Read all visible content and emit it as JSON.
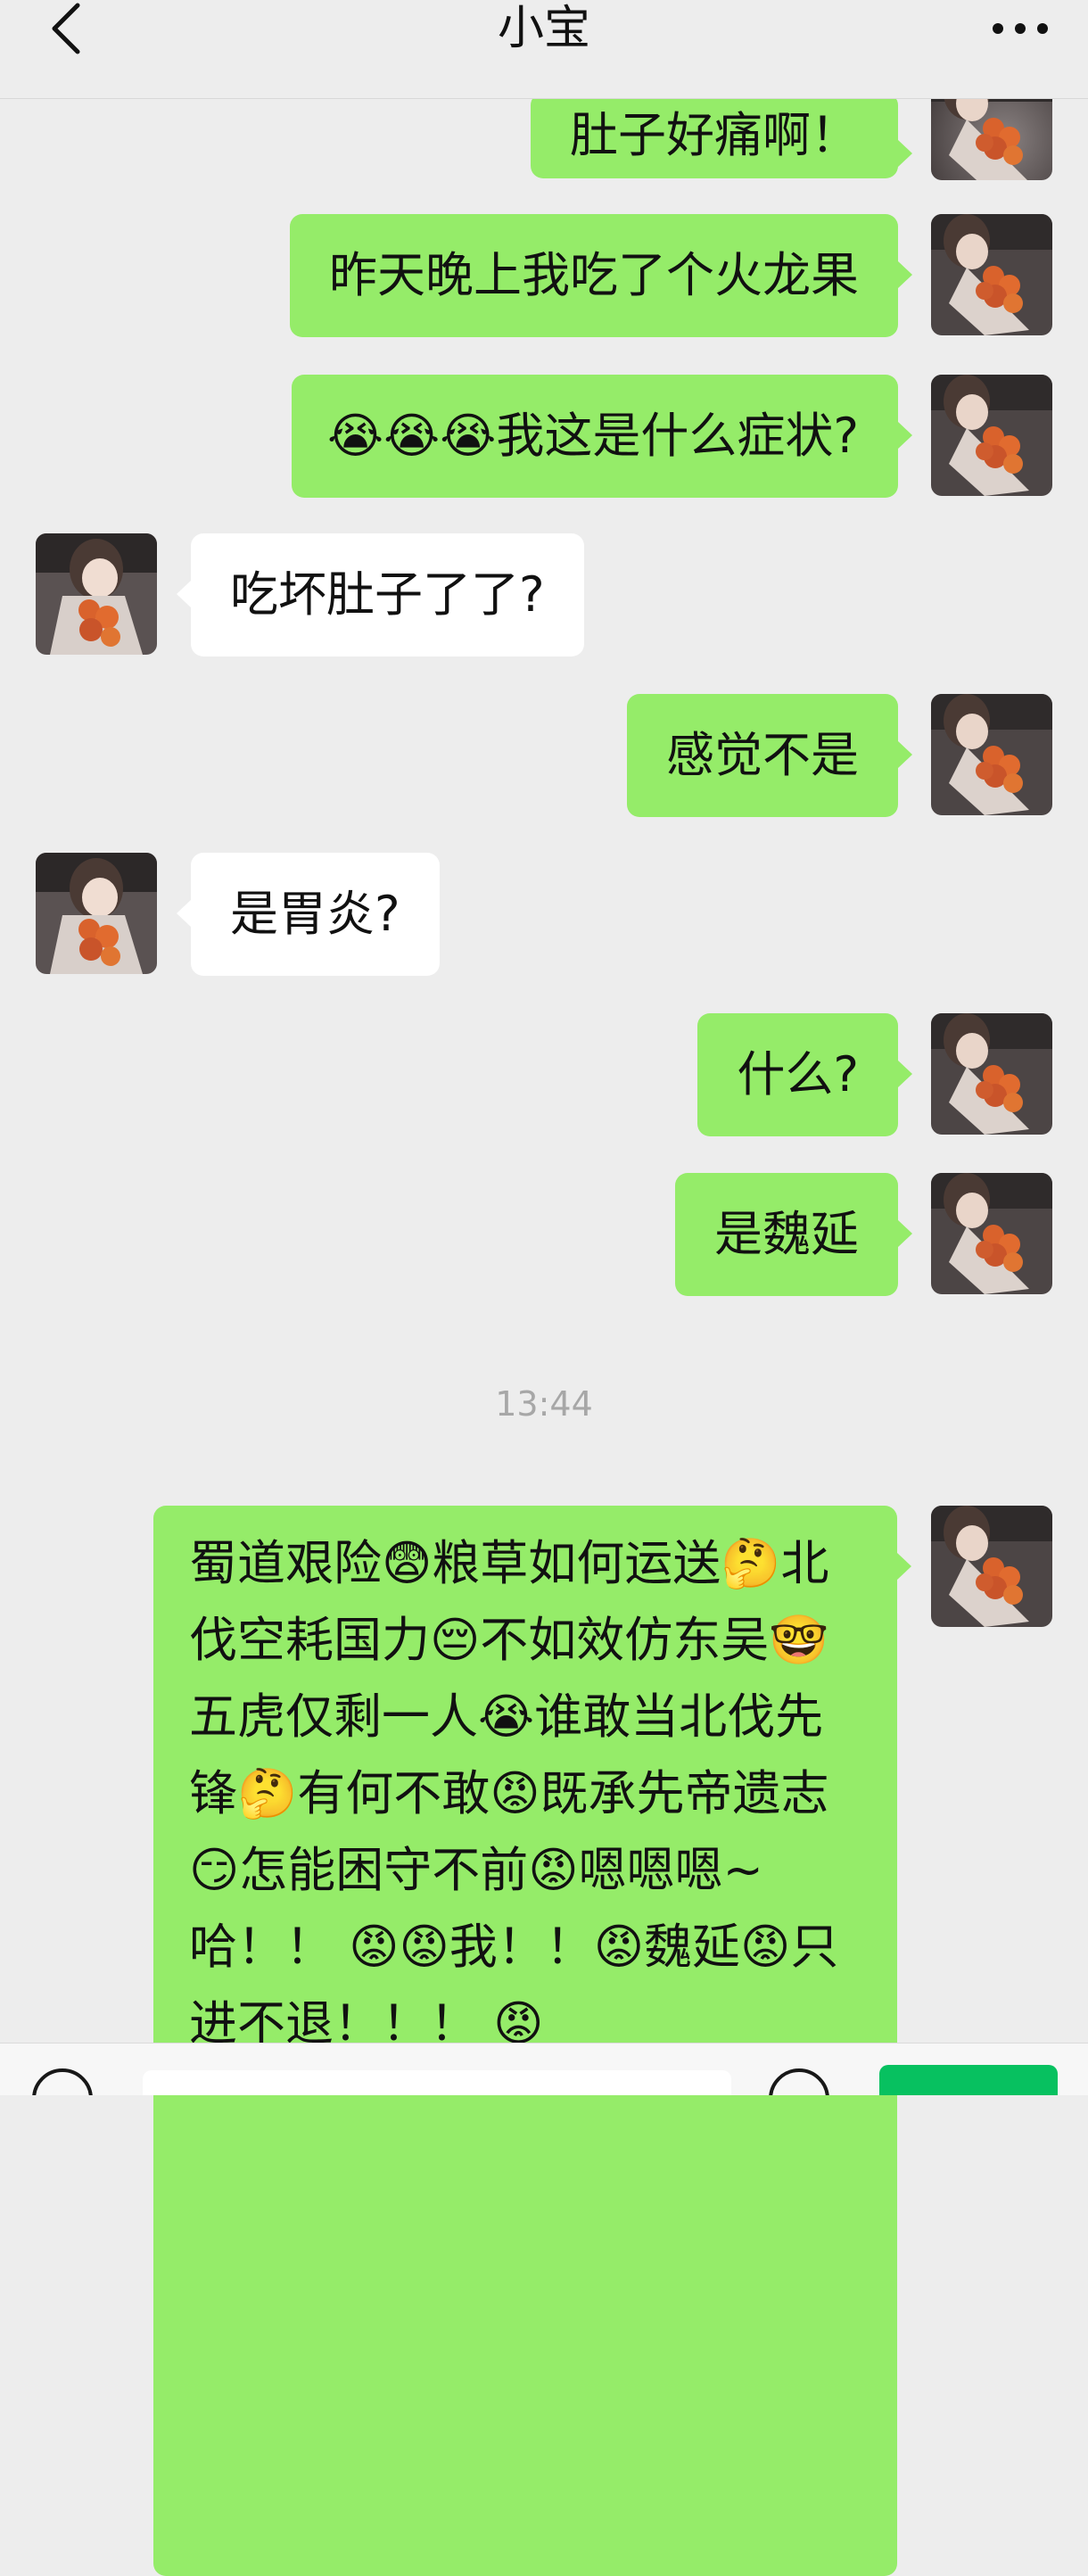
{
  "header": {
    "title": "小宝"
  },
  "messages": [
    {
      "side": "out",
      "text": "肚子好痛啊！"
    },
    {
      "side": "out",
      "text": "昨天晚上我吃了个火龙果"
    },
    {
      "side": "out",
      "text": "😭😭😭我这是什么症状?"
    },
    {
      "side": "in",
      "text": "吃坏肚子了了?"
    },
    {
      "side": "out",
      "text": "感觉不是"
    },
    {
      "side": "in",
      "text": "是胃炎?"
    },
    {
      "side": "out",
      "text": "什么?"
    },
    {
      "side": "out",
      "text": "是魏延"
    }
  ],
  "timestamp": "13:44",
  "long_message": {
    "side": "out",
    "text": "蜀道艰险😨粮草如何运送🤔北伐空耗国力😔不如效仿东吴🤓五虎仅剩一人😭谁敢当北伐先锋🤔有何不敢😡既承先帝遗志😏怎能困守不前😡嗯嗯嗯~哈！！ 😡😡我！！😡魏延😡只进不退！！！ 😡"
  },
  "icons": {
    "back": "chevron-left-icon",
    "more": "more-dots-icon",
    "voice": "voice-icon",
    "emoji": "emoji-icon"
  },
  "colors": {
    "background": "#ededed",
    "outgoing_bubble": "#95ec69",
    "incoming_bubble": "#ffffff",
    "send_button": "#07c160"
  }
}
